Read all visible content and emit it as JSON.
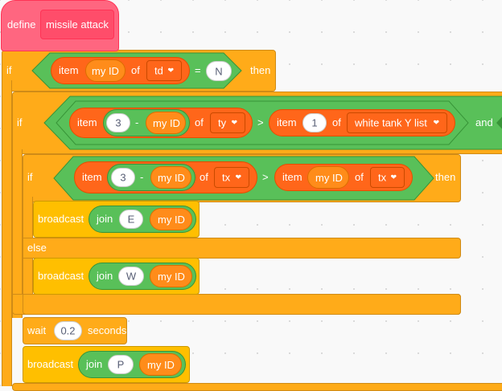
{
  "define": {
    "keyword": "define",
    "name": "missile attack"
  },
  "if1": {
    "keyword": "if",
    "then": "then",
    "item": "item",
    "var": "my ID",
    "of": "of",
    "list": "td",
    "op": "=",
    "value": "N"
  },
  "if2": {
    "keyword": "if",
    "and": "and",
    "item": "item",
    "num": "3",
    "minus": "-",
    "var": "my ID",
    "of": "of",
    "list": "ty",
    "gt": ">",
    "item2": "item",
    "num2": "1",
    "of2": "of",
    "list2": "white tank Y list"
  },
  "if3": {
    "keyword": "if",
    "then": "then",
    "item": "item",
    "num": "3",
    "minus": "-",
    "var": "my ID",
    "of": "of",
    "list": "tx",
    "gt": ">",
    "item2": "item",
    "var2": "my ID",
    "of2": "of",
    "list2": "tx"
  },
  "broadcast1": {
    "keyword": "broadcast",
    "join": "join",
    "letter": "E",
    "var": "my ID"
  },
  "else": {
    "keyword": "else"
  },
  "broadcast2": {
    "keyword": "broadcast",
    "join": "join",
    "letter": "W",
    "var": "my ID"
  },
  "wait": {
    "keyword": "wait",
    "value": "0.2",
    "unit": "seconds"
  },
  "broadcast3": {
    "keyword": "broadcast",
    "join": "join",
    "letter": "P",
    "var": "my ID"
  },
  "icons": {
    "dropdown": "caret-down-icon"
  },
  "colors": {
    "control": "#ffab19",
    "events": "#ffbf00",
    "operators": "#59c059",
    "lists": "#ff661a",
    "variables": "#ff8c1a",
    "my_blocks": "#ff6680"
  }
}
